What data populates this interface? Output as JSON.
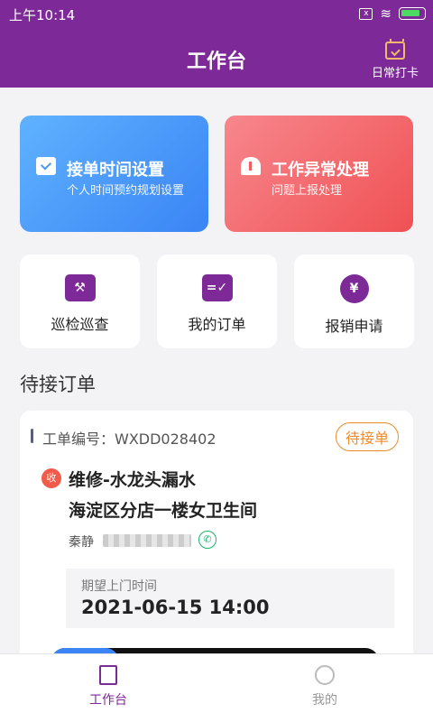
{
  "status_bar": {
    "time": "上午10:14"
  },
  "header": {
    "title": "工作台",
    "punch_label": "日常打卡"
  },
  "cards": [
    {
      "title": "接单时间设置",
      "subtitle": "个人时间预约规划设置"
    },
    {
      "title": "工作异常处理",
      "subtitle": "问题上报处理"
    }
  ],
  "quick_actions": [
    {
      "label": "巡检巡查",
      "glyph": "⚒"
    },
    {
      "label": "我的订单",
      "glyph": "=✓"
    },
    {
      "label": "报销申请",
      "glyph": "¥"
    }
  ],
  "section_title": "待接订单",
  "order": {
    "code_label": "工单编号：WXDD028402",
    "status": "待接单",
    "tag": "收",
    "title_line1": "维修-水龙头漏水",
    "title_line2": "海淀区分店一楼女卫生间",
    "contact_name": "秦静",
    "expect_label": "期望上门时间",
    "expect_time": "2021-06-15 14:00"
  },
  "tabs": [
    {
      "label": "工作台",
      "active": true
    },
    {
      "label": "我的",
      "active": false
    }
  ],
  "colors": {
    "brand": "#7d2a98",
    "blue": "#3a84f5",
    "red": "#f05154",
    "orange": "#f08a2a"
  }
}
